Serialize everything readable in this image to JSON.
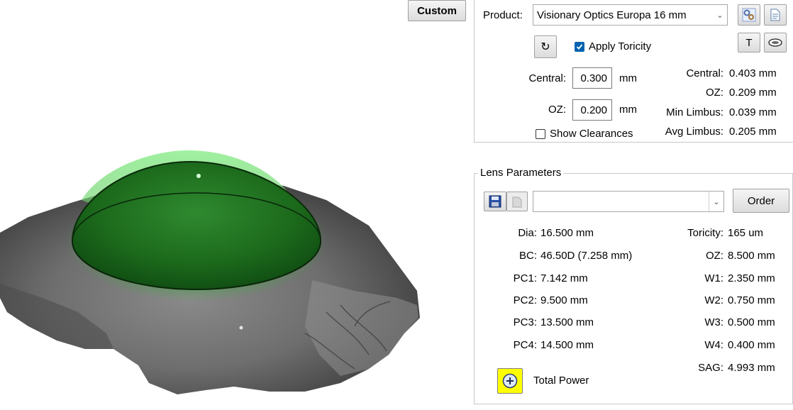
{
  "toolbar": {
    "custom_label": "Custom"
  },
  "product": {
    "label": "Product:",
    "selected": "Visionary Optics Europa 16 mm",
    "apply_toricity_label": "Apply Toricity",
    "apply_toricity_checked": true,
    "t_button_label": "T"
  },
  "clearance_inputs": {
    "central_label": "Central:",
    "central_value": "0.300",
    "central_unit": "mm",
    "oz_label": "OZ:",
    "oz_value": "0.200",
    "oz_unit": "mm",
    "show_clearances_label": "Show Clearances",
    "show_clearances_checked": false
  },
  "clearance_results": [
    {
      "label": "Central:",
      "value": "0.403 mm"
    },
    {
      "label": "OZ:",
      "value": "0.209 mm"
    },
    {
      "label": "Min Limbus:",
      "value": "0.039 mm"
    },
    {
      "label": "Avg Limbus:",
      "value": "0.205 mm"
    }
  ],
  "lens_parameters": {
    "title": "Lens Parameters",
    "preset_selected": "",
    "order_label": "Order",
    "left": [
      {
        "label": "Dia:",
        "value": "16.500 mm"
      },
      {
        "label": "BC:",
        "value": "46.50D (7.258 mm)"
      },
      {
        "label": "PC1:",
        "value": "7.142 mm"
      },
      {
        "label": "PC2:",
        "value": "9.500 mm"
      },
      {
        "label": "PC3:",
        "value": "13.500 mm"
      },
      {
        "label": "PC4:",
        "value": "14.500 mm"
      }
    ],
    "right": [
      {
        "label": "Toricity:",
        "value": "165 um"
      },
      {
        "label": "OZ:",
        "value": "8.500 mm"
      },
      {
        "label": "W1:",
        "value": "2.350 mm"
      },
      {
        "label": "W2:",
        "value": "0.750 mm"
      },
      {
        "label": "W3:",
        "value": "0.500 mm"
      },
      {
        "label": "W4:",
        "value": "0.400 mm"
      },
      {
        "label": "SAG:",
        "value": "4.993 mm"
      }
    ],
    "total_power_label": "Total Power"
  },
  "icons": {
    "refresh": "refresh-icon",
    "settings": "gear-icon",
    "document": "document-icon",
    "eye": "eye-icon",
    "save": "save-icon",
    "copy": "copy-icon",
    "plus": "plus-icon"
  },
  "colors": {
    "lens_green": "#1f7a1f",
    "highlight_green": "#7ae07a",
    "checkbox_blue": "#0063b1",
    "plus_button_yellow": "#ffff00"
  }
}
